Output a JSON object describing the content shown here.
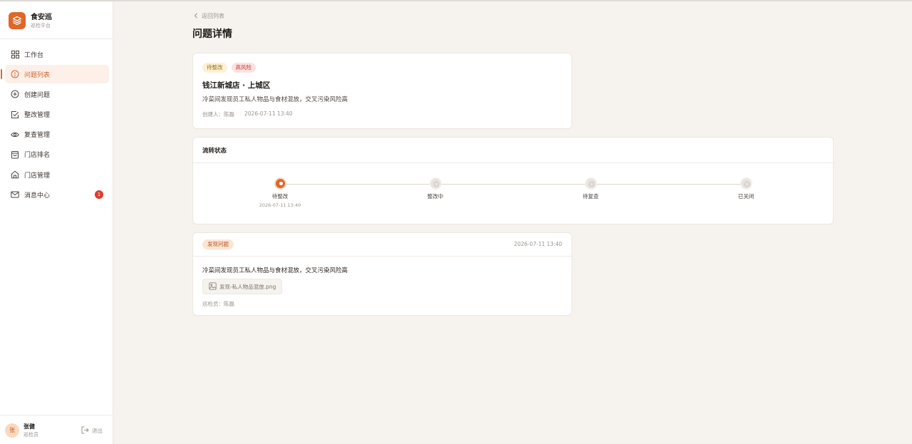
{
  "app": {
    "name": "食安巡",
    "subtitle": "巡检平台"
  },
  "sidebar": {
    "items": [
      {
        "label": "工作台",
        "icon": "grid-icon"
      },
      {
        "label": "问题列表",
        "icon": "alert-circle-icon",
        "active": true
      },
      {
        "label": "创建问题",
        "icon": "plus-circle-icon"
      },
      {
        "label": "整改管理",
        "icon": "check-square-icon"
      },
      {
        "label": "复查管理",
        "icon": "eye-icon"
      },
      {
        "label": "门店排名",
        "icon": "bag-icon"
      },
      {
        "label": "门店管理",
        "icon": "home-icon"
      },
      {
        "label": "消息中心",
        "icon": "mail-icon",
        "badge": "1"
      }
    ]
  },
  "user": {
    "avatar": "张",
    "name": "张健",
    "role": "巡检员",
    "logout_label": "退出"
  },
  "header": {
    "back_label": "返回列表",
    "title": "问题详情"
  },
  "issue": {
    "tags": [
      "待整改",
      "高风险"
    ],
    "store": "钱江新城店 · 上城区",
    "description": "冷菜间发现员工私人物品与食材混放，交叉污染风险高",
    "creator": "创建人：陈磊",
    "created_at": "2026-07-11 13:40"
  },
  "flow": {
    "title": "流转状态",
    "steps": [
      {
        "label": "待整改",
        "time": "2026-07-11 13:40",
        "active": true
      },
      {
        "label": "整改中",
        "time": ""
      },
      {
        "label": "待复查",
        "time": ""
      },
      {
        "label": "已关闭",
        "time": ""
      }
    ]
  },
  "record": {
    "tag": "发现问题",
    "time": "2026-07-11 13:40",
    "text": "冷菜间发现员工私人物品与食材混放，交叉污染风险高",
    "attachment": "发现-私人物品混放.png",
    "inspector": "巡检员：陈磊"
  },
  "colors": {
    "accent": "#e0662a",
    "badge": "#e03a2e"
  }
}
